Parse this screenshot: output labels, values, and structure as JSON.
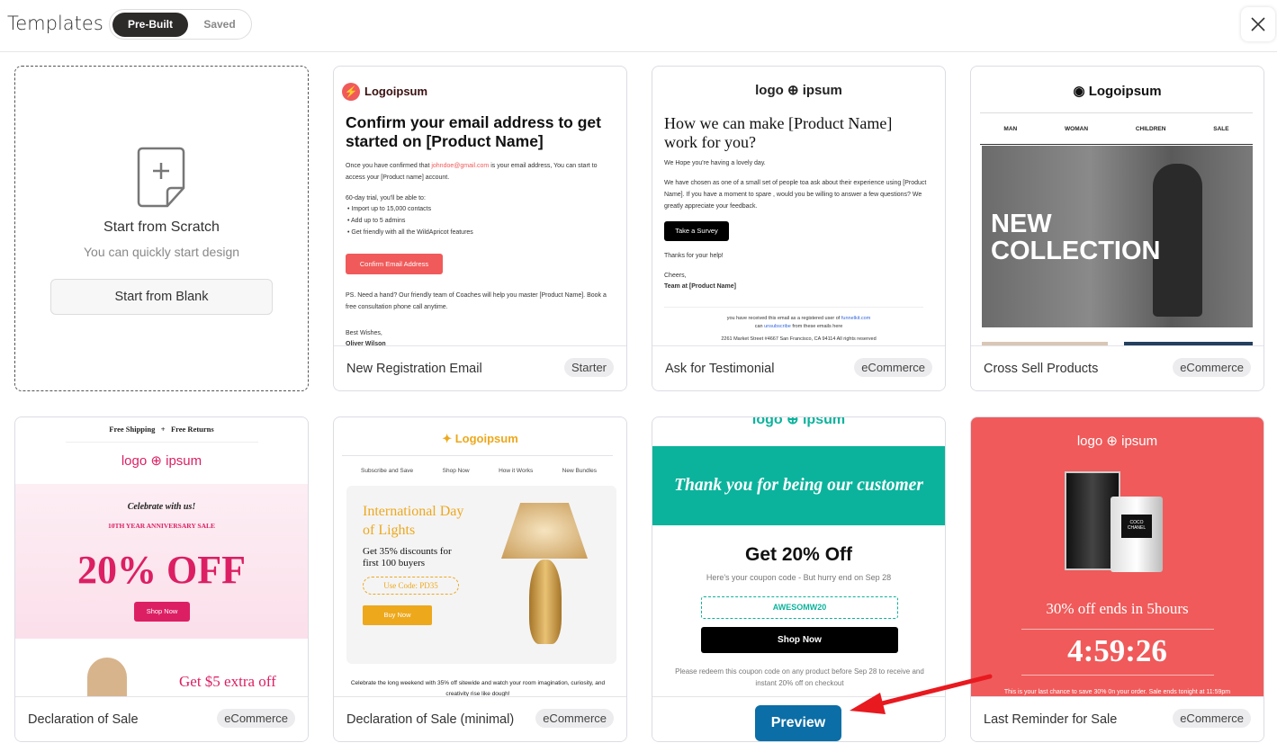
{
  "header": {
    "title": "Templates",
    "tabs": [
      {
        "label": "Pre-Built",
        "active": true
      },
      {
        "label": "Saved",
        "active": false
      }
    ],
    "close_icon": "close-icon"
  },
  "scratch": {
    "title": "Start from Scratch",
    "subtitle": "You can quickly start design",
    "button": "Start from Blank",
    "icon": "new-document-icon"
  },
  "cards": [
    {
      "name": "New Registration Email",
      "badge": "Starter",
      "preview": {
        "logo": "Logoipsum",
        "heading": "Confirm your email address to get started on [Product Name]",
        "p1a": "Once you have confirmed that ",
        "email": "johndoe@gmail.com",
        "p1b": " is  your email address, You can start to access your [Product name] account.",
        "p2": "60-day trial, you'll be able to:",
        "bullets": [
          "Import up to 15,000 contacts",
          "Add up to 5 admins",
          "Get friendly with all the WildApricot features"
        ],
        "button": "Confirm Email Address",
        "p3": "PS. Need a hand? Our friendly team of Coaches will help you master [Product Name]. Book a free consultation phone call anytime.",
        "sign": "Best Wishes,",
        "signer": "Oliver Wilson"
      }
    },
    {
      "name": "Ask for Testimonial",
      "badge": "eCommerce",
      "preview": {
        "logo_a": "logo",
        "logo_b": "ipsum",
        "heading": "How we can make [Product Name] work for you?",
        "p1": "We Hope you're having a lovely day.",
        "p2": "We have chosen as one of a small set of people toa ask about their  experience using [Product Name]. If you have a moment to spare , would you be willing to answer a few questions? We greatly appreciate your feedback.",
        "button": "Take a Survey",
        "p3": "Thanks for your help!",
        "p4": "Cheers,",
        "p5": "Team at [Product Name]",
        "f1a": "you have received this email as a registered user of ",
        "f1link": "funnelkit.com",
        "f2a": "can ",
        "f2link": "unsubscribe",
        "f2b": " from these emails here",
        "f3": "2261 Market Street #4667 San Francisco, CA 94114 All rights reserved"
      }
    },
    {
      "name": "Cross Sell Products",
      "badge": "eCommerce",
      "preview": {
        "logo": "Logoipsum",
        "nav": [
          "MAN",
          "WOMAN",
          "CHILDREN",
          "SALE"
        ],
        "hero": "NEW COLLECTION"
      }
    },
    {
      "name": "Declaration of Sale",
      "badge": "eCommerce",
      "preview": {
        "top_a": "Free Shipping",
        "top_plus": "+",
        "top_b": "Free Returns",
        "logo_a": "logo",
        "logo_b": "ipsum",
        "celebrate": "Celebrate with us!",
        "sale": "10TH YEAR ANNIVERSARY SALE",
        "off": "20% OFF",
        "button": "Shop Now",
        "extra": "Get $5 extra off"
      }
    },
    {
      "name": "Declaration of Sale (minimal)",
      "badge": "eCommerce",
      "preview": {
        "logo": "Logoipsum",
        "nav": [
          "Subscribe and Save",
          "Shop Now",
          "How it Works",
          "New Bundles"
        ],
        "heading": "International Day of Lights",
        "sub": "Get 35% discounts for first 100 buyers",
        "code": "Use Code: PD35",
        "button": "Buy Now",
        "p": "Celebrate the long weekend with 35% off sitewide and watch your room imagination, curiosity, and creativity rise like dough!"
      }
    },
    {
      "name": "",
      "badge": "",
      "preview_button": "Preview",
      "preview": {
        "logo_a": "logo",
        "logo_b": "ipsum",
        "banner": "Thank you for being our customer",
        "heading": "Get 20% Off",
        "sub": "Here's your coupon code - But hurry end on  Sep 28",
        "code": "AWESOMW20",
        "button": "Shop Now",
        "p": "Please redeem this coupon code on any product before Sep 28 to receive and instant 20% off on checkout"
      }
    },
    {
      "name": "Last Reminder for Sale",
      "badge": "eCommerce",
      "preview": {
        "logo_a": "logo",
        "logo_b": "ipsum",
        "product_label": "COCO CHANEL",
        "headline": "30% off ends in 5hours",
        "timer": "4:59:26",
        "p": "This is your last chance to save 30% 0n your order. Sale ends tonight at 11:59pm"
      }
    }
  ],
  "colors": {
    "accent_red": "#f05a5a",
    "teal": "#0bb39c",
    "pink": "#dc1f63",
    "gold": "#eda81c",
    "preview_blue": "#0b6ea6",
    "arrow": "#e8191f"
  }
}
